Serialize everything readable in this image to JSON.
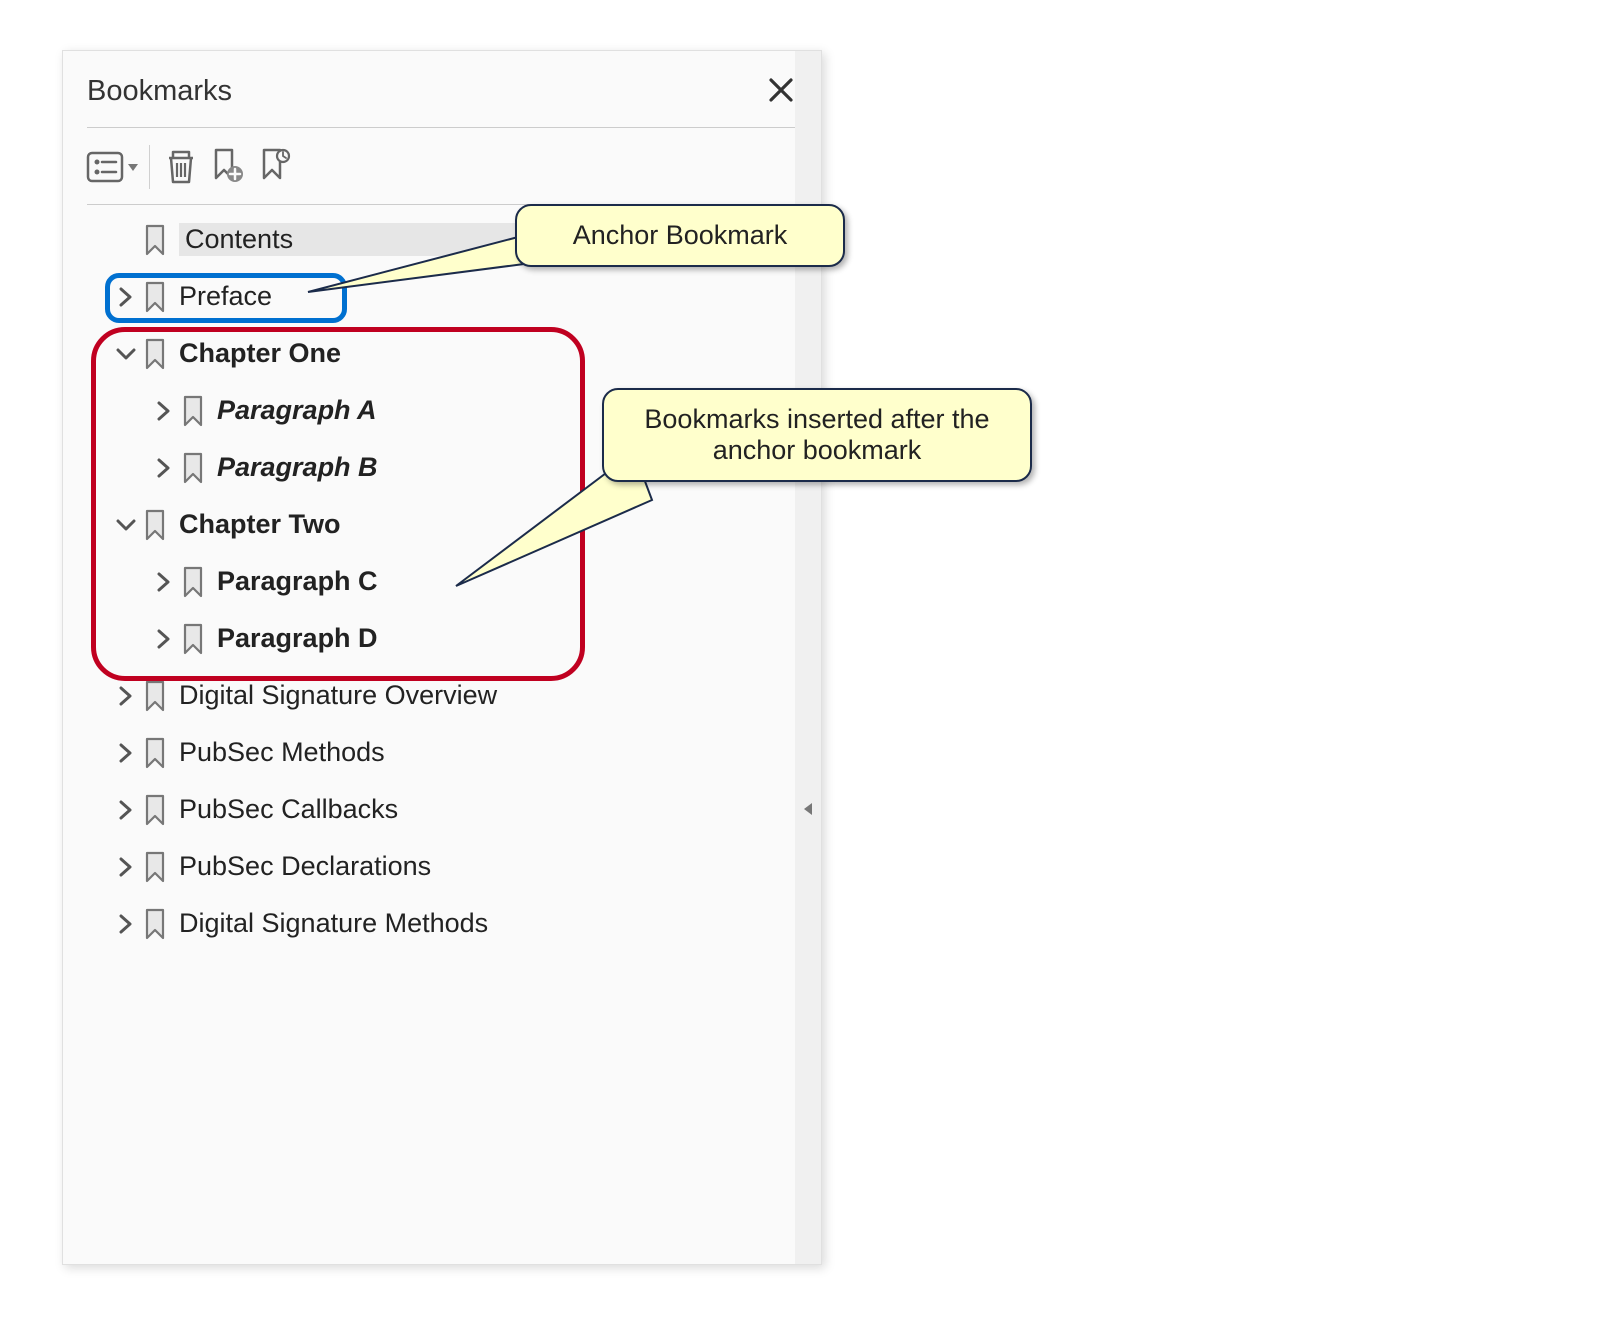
{
  "panel": {
    "title": "Bookmarks"
  },
  "toolbar": {
    "options_icon": "options",
    "delete_icon": "delete",
    "add_icon": "new-bookmark",
    "find_icon": "find-bookmark"
  },
  "tree": [
    {
      "label": "Contents",
      "indent": 1,
      "hasChildren": false,
      "expanded": false,
      "bold": false,
      "italic": false,
      "selected": true
    },
    {
      "label": "Preface",
      "indent": 1,
      "hasChildren": true,
      "expanded": false,
      "bold": false,
      "italic": false,
      "selected": false
    },
    {
      "label": "Chapter One",
      "indent": 1,
      "hasChildren": true,
      "expanded": true,
      "bold": true,
      "italic": false,
      "selected": false
    },
    {
      "label": "Paragraph A",
      "indent": 2,
      "hasChildren": true,
      "expanded": false,
      "bold": true,
      "italic": true,
      "selected": false
    },
    {
      "label": "Paragraph B",
      "indent": 2,
      "hasChildren": true,
      "expanded": false,
      "bold": true,
      "italic": true,
      "selected": false
    },
    {
      "label": "Chapter Two",
      "indent": 1,
      "hasChildren": true,
      "expanded": true,
      "bold": true,
      "italic": false,
      "selected": false
    },
    {
      "label": "Paragraph C",
      "indent": 2,
      "hasChildren": true,
      "expanded": false,
      "bold": true,
      "italic": false,
      "selected": false
    },
    {
      "label": "Paragraph D",
      "indent": 2,
      "hasChildren": true,
      "expanded": false,
      "bold": true,
      "italic": false,
      "selected": false
    },
    {
      "label": "Digital Signature Overview",
      "indent": 1,
      "hasChildren": true,
      "expanded": false,
      "bold": false,
      "italic": false,
      "selected": false
    },
    {
      "label": "PubSec Methods",
      "indent": 1,
      "hasChildren": true,
      "expanded": false,
      "bold": false,
      "italic": false,
      "selected": false
    },
    {
      "label": "PubSec Callbacks",
      "indent": 1,
      "hasChildren": true,
      "expanded": false,
      "bold": false,
      "italic": false,
      "selected": false
    },
    {
      "label": "PubSec Declarations",
      "indent": 1,
      "hasChildren": true,
      "expanded": false,
      "bold": false,
      "italic": false,
      "selected": false
    },
    {
      "label": "Digital Signature Methods",
      "indent": 1,
      "hasChildren": true,
      "expanded": false,
      "bold": false,
      "italic": false,
      "selected": false
    }
  ],
  "callouts": {
    "anchor": "Anchor Bookmark",
    "inserted": "Bookmarks inserted after the anchor bookmark"
  }
}
